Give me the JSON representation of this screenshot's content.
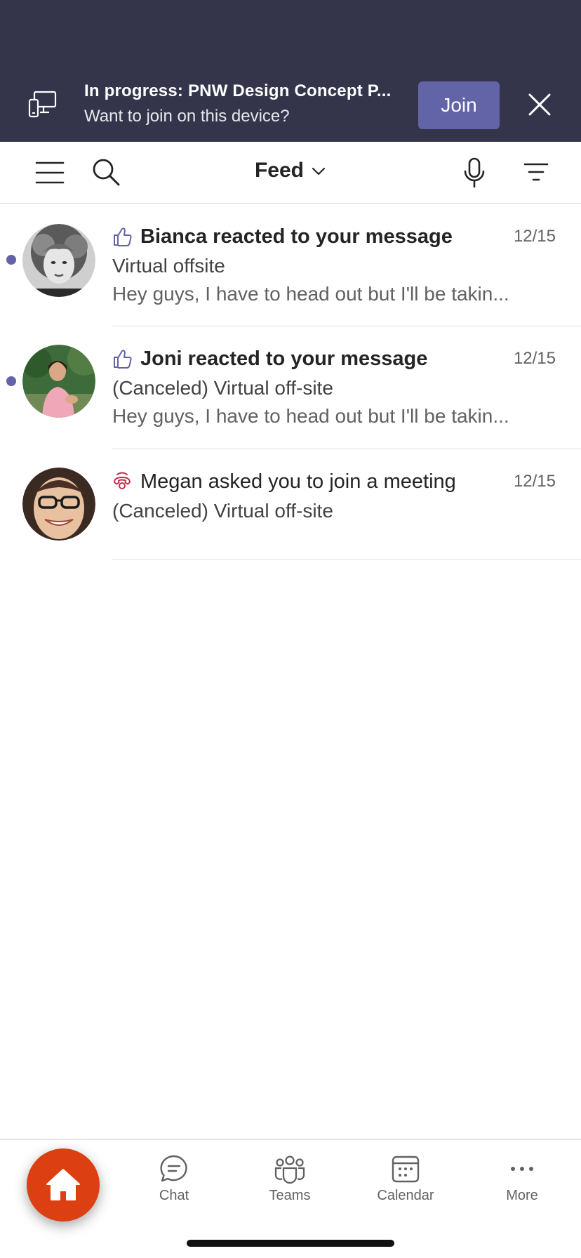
{
  "banner": {
    "title": "In progress: PNW Design Concept P...",
    "subtitle": "Want to join on this device?",
    "join_label": "Join",
    "icons": {
      "device": "device-switch-icon",
      "close": "close-icon"
    }
  },
  "toolbar": {
    "title": "Feed",
    "icons": {
      "menu": "hamburger-menu-icon",
      "search": "search-icon",
      "dropdown": "chevron-down-icon",
      "mic": "microphone-icon",
      "filter": "filter-icon"
    }
  },
  "feed": {
    "items": [
      {
        "headline": "Bianca reacted to your message",
        "line1": "Virtual offsite",
        "line2": "Hey guys, I have to head out but I'll be takin...",
        "date": "12/15",
        "unread": true,
        "icon": "thumbs-up-icon"
      },
      {
        "headline": "Joni reacted to your message",
        "line1": "(Canceled) Virtual off-site",
        "line2": "Hey guys, I have to head out but I'll be takin...",
        "date": "12/15",
        "unread": true,
        "icon": "thumbs-up-icon"
      },
      {
        "headline": "Megan asked you to join a meeting",
        "line1": "(Canceled) Virtual off-site",
        "date": "12/15",
        "unread": false,
        "icon": "phone-ring-icon"
      }
    ]
  },
  "tabbar": {
    "home_icon": "home-icon",
    "tabs": [
      {
        "label": "Chat",
        "icon": "chat-icon"
      },
      {
        "label": "Teams",
        "icon": "teams-icon"
      },
      {
        "label": "Calendar",
        "icon": "calendar-icon"
      },
      {
        "label": "More",
        "icon": "more-dots-icon"
      }
    ]
  },
  "colors": {
    "banner_bg": "#34354a",
    "accent": "#6264a7",
    "home_fab": "#dc3f12",
    "missed_call_red": "#c4314b"
  }
}
